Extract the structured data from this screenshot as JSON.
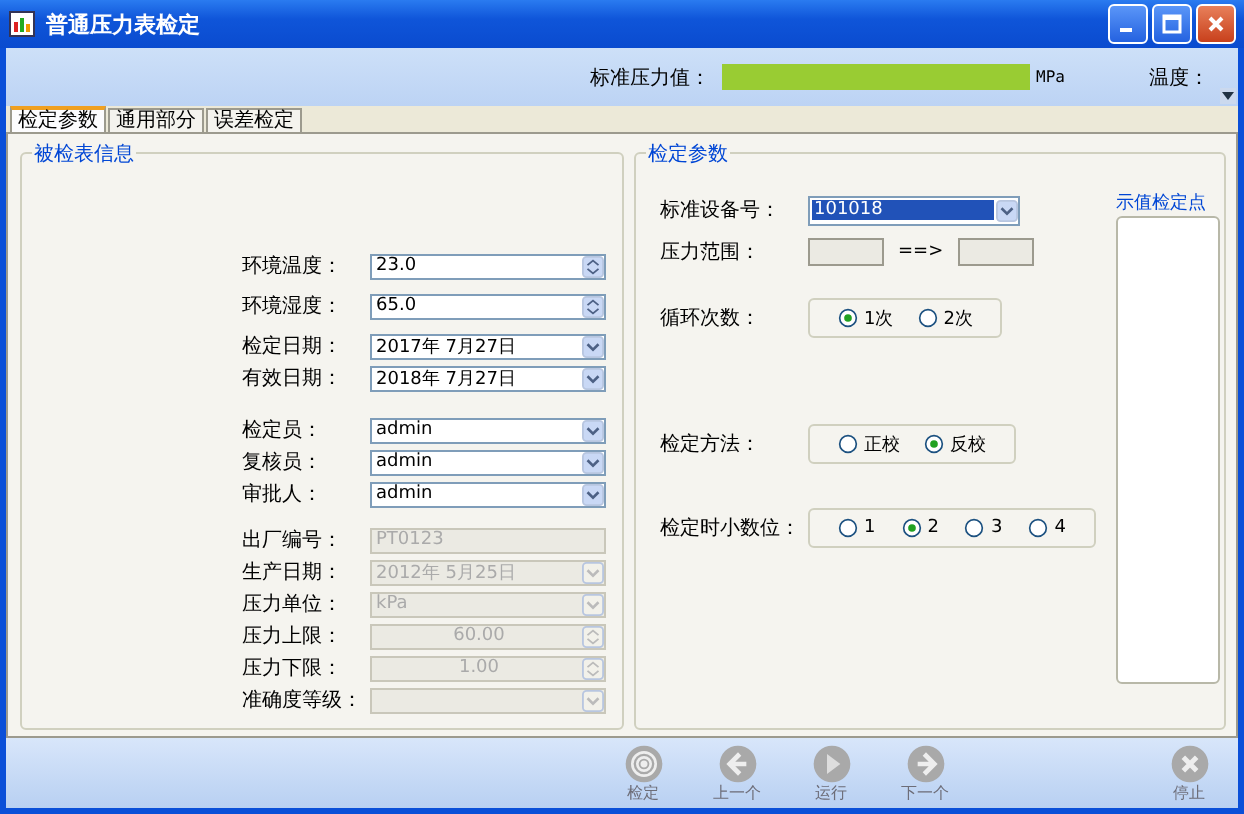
{
  "window": {
    "title": "普通压力表检定"
  },
  "header": {
    "pressure_label": "标准压力值：",
    "pressure_unit": "MPa",
    "temperature_label": "温度："
  },
  "tabs": [
    {
      "label": "检定参数",
      "selected": true
    },
    {
      "label": "通用部分",
      "selected": false
    },
    {
      "label": "误差检定",
      "selected": false
    }
  ],
  "left_group": {
    "title": "被检表信息",
    "groups": [
      [
        {
          "label": "环境温度：",
          "kind": "spin",
          "value": "23.0",
          "disabled": false
        },
        {
          "label": "环境湿度：",
          "kind": "spin",
          "value": "65.0",
          "disabled": false
        }
      ],
      [
        {
          "label": "检定日期：",
          "kind": "combo",
          "value": "2017年 7月27日",
          "disabled": false
        },
        {
          "label": "有效日期：",
          "kind": "combo",
          "value": "2018年 7月27日",
          "disabled": false
        }
      ],
      [
        {
          "label": "检定员：",
          "kind": "combo",
          "value": "admin",
          "disabled": false
        },
        {
          "label": "复核员：",
          "kind": "combo",
          "value": "admin",
          "disabled": false
        },
        {
          "label": "审批人：",
          "kind": "combo",
          "value": "admin",
          "disabled": false
        }
      ],
      [
        {
          "label": "出厂编号：",
          "kind": "text",
          "value": "PT0123",
          "disabled": true
        },
        {
          "label": "生产日期：",
          "kind": "combo",
          "value": "2012年 5月25日",
          "disabled": true
        },
        {
          "label": "压力单位：",
          "kind": "combo",
          "value": "kPa",
          "disabled": true
        },
        {
          "label": "压力上限：",
          "kind": "spin",
          "value": "60.00",
          "disabled": true
        },
        {
          "label": "压力下限：",
          "kind": "spin",
          "value": "1.00",
          "disabled": true
        },
        {
          "label": "准确度等级：",
          "kind": "combo",
          "disabled": true
        }
      ]
    ]
  },
  "right_group": {
    "title": "检定参数",
    "device": {
      "label": "标准设备号：",
      "value": "101018"
    },
    "range": {
      "label": "压力范围：",
      "arrow": "==>"
    },
    "options": [
      {
        "label": "循环次数：",
        "choices": [
          {
            "label": "1次",
            "selected": true
          },
          {
            "label": "2次",
            "selected": false
          }
        ]
      },
      {
        "label": "检定方法：",
        "choices": [
          {
            "label": "正校",
            "selected": false
          },
          {
            "label": "反校",
            "selected": true
          }
        ]
      },
      {
        "label": "检定时小数位：",
        "choices": [
          {
            "label": "1",
            "selected": false
          },
          {
            "label": "2",
            "selected": true
          },
          {
            "label": "3",
            "selected": false
          },
          {
            "label": "4",
            "selected": false
          }
        ]
      }
    ],
    "points_title": "示值检定点"
  },
  "toolbar": [
    {
      "label": "检定",
      "kind": "target",
      "disabled": true
    },
    {
      "label": "上一个",
      "kind": "prev",
      "disabled": true
    },
    {
      "label": "运行",
      "kind": "play",
      "disabled": true
    },
    {
      "label": "下一个",
      "kind": "next",
      "disabled": true
    },
    {
      "label": "停止",
      "kind": "stop",
      "disabled": true
    }
  ]
}
